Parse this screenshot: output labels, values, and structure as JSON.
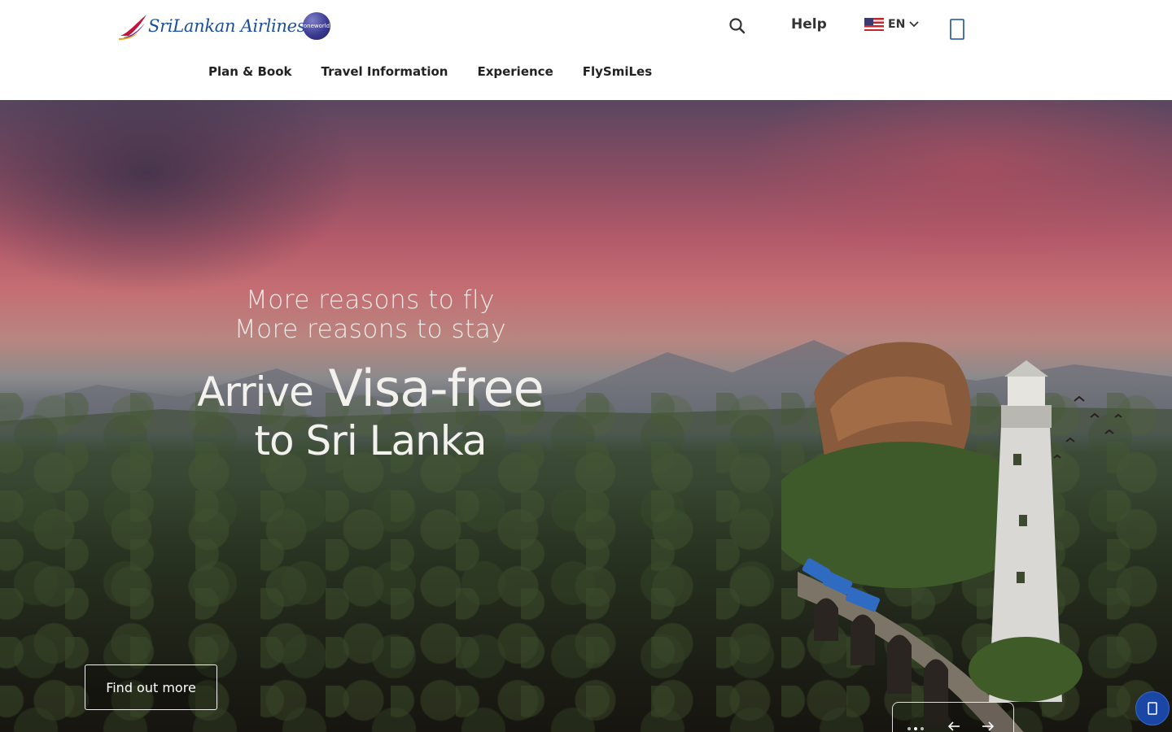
{
  "brand": {
    "name": "SriLankan Airlines",
    "alliance_badge": "oneworld",
    "accent_color": "#1b4f9c"
  },
  "header": {
    "help_label": "Help",
    "language_code": "EN",
    "icons": {
      "search": "search-icon",
      "user": "user-icon",
      "language_flag": "us-flag-icon",
      "dropdown": "chevron-down-icon"
    }
  },
  "nav": {
    "items": [
      {
        "label": "Plan & Book"
      },
      {
        "label": "Travel Information"
      },
      {
        "label": "Experience"
      },
      {
        "label": "FlySmiLes"
      }
    ]
  },
  "hero": {
    "line1": "More reasons to fly",
    "line2": "More reasons to stay",
    "headline_part1": "Arrive",
    "headline_part2": "Visa-free",
    "headline_line2": "to Sri Lanka",
    "cta_label": "Find out more"
  },
  "carousel": {
    "slide_count": 3,
    "active_index": 1,
    "icons": {
      "prev": "arrow-left-icon",
      "next": "arrow-right-icon"
    }
  },
  "chat": {
    "icon": "chat-icon",
    "color": "#1a47a6"
  }
}
